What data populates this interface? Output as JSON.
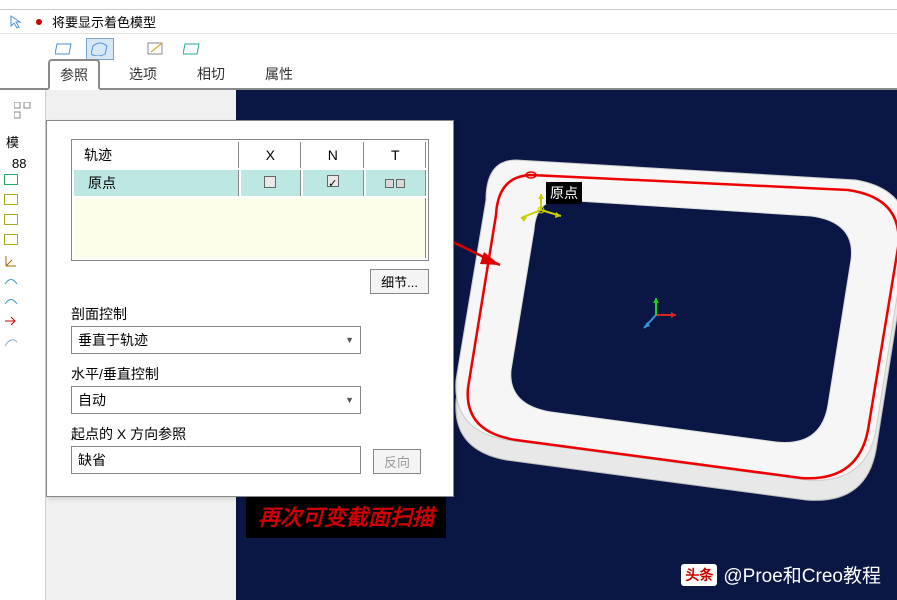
{
  "status": {
    "text": "将要显示着色模型"
  },
  "tabs": {
    "t1": "参照",
    "t2": "选项",
    "t3": "相切",
    "t4": "属性"
  },
  "sidebar": {
    "label": "模",
    "num": "88"
  },
  "panel": {
    "table_headers": {
      "track": "轨迹",
      "x": "X",
      "n": "N",
      "t": "T"
    },
    "row0": {
      "name": "原点"
    },
    "detail_btn": "细节...",
    "section_control_label": "剖面控制",
    "section_control_value": "垂直于轨迹",
    "hv_control_label": "水平/垂直控制",
    "hv_control_value": "自动",
    "start_x_label": "起点的 X 方向参照",
    "start_x_value": "缺省",
    "reverse_btn": "反向"
  },
  "viewport": {
    "origin_label": "原点",
    "overlay_text": "再次可变截面扫描",
    "watermark_badge": "头条",
    "watermark_text": "@Proe和Creo教程"
  }
}
